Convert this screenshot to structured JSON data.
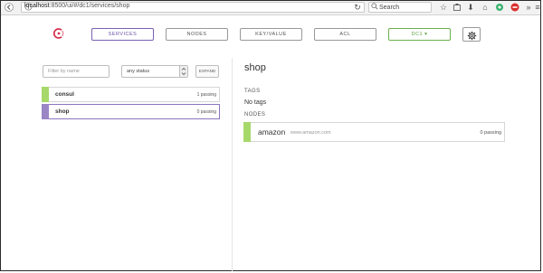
{
  "browser": {
    "url_host": "localhost",
    "url_path": ":8500/ui/#/dc1/services/shop",
    "search_placeholder": "Search"
  },
  "nav": {
    "services": "SERVICES",
    "nodes": "NODES",
    "keyvalue": "KEY/VALUE",
    "acl": "ACL",
    "datacenter": "DC1 ▾"
  },
  "filters": {
    "name_placeholder": "Filter by name",
    "status_value": "any status",
    "expand_label": "EXPAND"
  },
  "services": [
    {
      "name": "consul",
      "status": "1 passing"
    },
    {
      "name": "shop",
      "status": "0 passing"
    }
  ],
  "detail": {
    "title": "shop",
    "tags_label": "TAGS",
    "tags_value": "No tags",
    "nodes_label": "NODES",
    "nodes": [
      {
        "name": "amazon",
        "address": "www.amazon.com",
        "status": "0 passing"
      }
    ]
  },
  "colors": {
    "accent_purple": "#7a5fb3",
    "passing_green": "#a6d96a",
    "selected_purple": "#9b86c6",
    "dc_green": "#6ab04c"
  }
}
